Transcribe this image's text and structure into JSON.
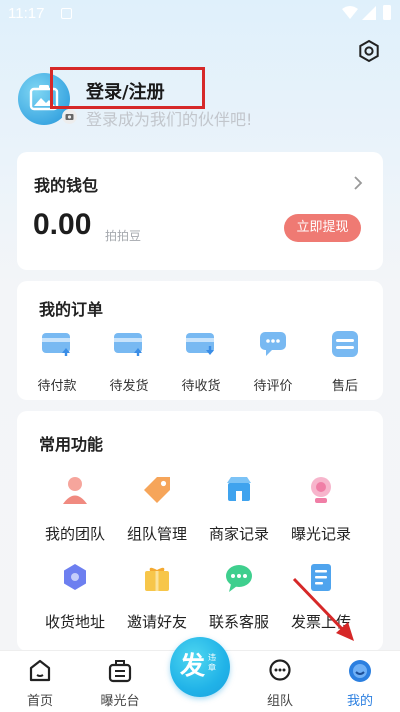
{
  "status_bar": {
    "time": "11:17"
  },
  "profile": {
    "title": "登录/注册",
    "subtitle": "登录成为我们的伙伴吧!"
  },
  "wallet": {
    "title": "我的钱包",
    "amount": "0.00",
    "unit": "拍拍豆",
    "withdraw_label": "立即提现",
    "withdraw_color": "#ef7a73"
  },
  "orders": {
    "title": "我的订单",
    "items": [
      {
        "label": "待付款",
        "icon": "pending-payment-icon"
      },
      {
        "label": "待发货",
        "icon": "pending-shipment-icon"
      },
      {
        "label": "待收货",
        "icon": "pending-receipt-icon"
      },
      {
        "label": "待评价",
        "icon": "pending-review-icon"
      },
      {
        "label": "售后",
        "icon": "after-sales-icon"
      }
    ]
  },
  "functions": {
    "title": "常用功能",
    "items": [
      {
        "label": "我的团队",
        "icon": "team-icon",
        "color": "#f08a80"
      },
      {
        "label": "组队管理",
        "icon": "tag-icon",
        "color": "#f6a55a"
      },
      {
        "label": "商家记录",
        "icon": "store-icon",
        "color": "#3fa3ee"
      },
      {
        "label": "曝光记录",
        "icon": "exposure-icon",
        "color": "#f07ea6"
      },
      {
        "label": "收货地址",
        "icon": "address-icon",
        "color": "#6d7ff0"
      },
      {
        "label": "邀请好友",
        "icon": "gift-icon",
        "color": "#f7c64a"
      },
      {
        "label": "联系客服",
        "icon": "chat-icon",
        "color": "#3fcf8e"
      },
      {
        "label": "发票上传",
        "icon": "invoice-icon",
        "color": "#4fa4ee"
      }
    ]
  },
  "bottom_nav": {
    "items": [
      {
        "label": "首页",
        "icon": "home-icon"
      },
      {
        "label": "曝光台",
        "icon": "exposure-desk-icon"
      },
      {
        "label": "组队",
        "icon": "team-chat-icon"
      },
      {
        "label": "我的",
        "icon": "profile-icon"
      }
    ],
    "fab": {
      "main": "发",
      "sub": "违章"
    },
    "active_color": "#2b7fe0"
  }
}
